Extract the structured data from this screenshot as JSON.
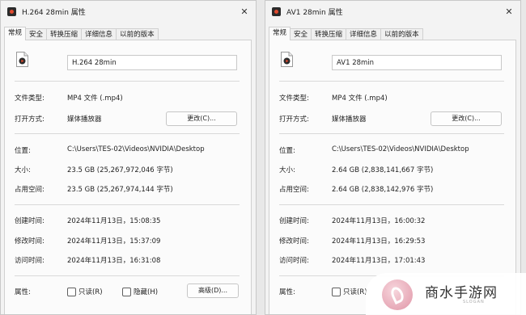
{
  "windows": [
    {
      "title": "H.264 28min 属性",
      "tabs": [
        "常规",
        "安全",
        "转换压缩",
        "详细信息",
        "以前的版本"
      ],
      "file_name": "H.264 28min",
      "file_type_label": "文件类型:",
      "file_type": "MP4 文件 (.mp4)",
      "open_with_label": "打开方式:",
      "open_with": "媒体播放器",
      "change_button": "更改(C)...",
      "location_label": "位置:",
      "location": "C:\\Users\\TES-02\\Videos\\NVIDIA\\Desktop",
      "size_label": "大小:",
      "size": "23.5 GB (25,267,972,046 字节)",
      "size_on_disk_label": "占用空间:",
      "size_on_disk": "23.5 GB (25,267,974,144 字节)",
      "created_label": "创建时间:",
      "created": "2024年11月13日，15:08:35",
      "modified_label": "修改时间:",
      "modified": "2024年11月13日，15:37:09",
      "accessed_label": "访问时间:",
      "accessed": "2024年11月13日，16:31:08",
      "attributes_label": "属性:",
      "readonly_label": "只读(R)",
      "hidden_label": "隐藏(H)",
      "advanced_button": "高级(D)..."
    },
    {
      "title": "AV1 28min 属性",
      "tabs": [
        "常规",
        "安全",
        "转换压缩",
        "详细信息",
        "以前的版本"
      ],
      "file_name": "AV1 28min",
      "file_type_label": "文件类型:",
      "file_type": "MP4 文件 (.mp4)",
      "open_with_label": "打开方式:",
      "open_with": "媒体播放器",
      "change_button": "更改(C)...",
      "location_label": "位置:",
      "location": "C:\\Users\\TES-02\\Videos\\NVIDIA\\Desktop",
      "size_label": "大小:",
      "size": "2.64 GB (2,838,141,667 字节)",
      "size_on_disk_label": "占用空间:",
      "size_on_disk": "2.64 GB (2,838,142,976 字节)",
      "created_label": "创建时间:",
      "created": "2024年11月13日，16:00:32",
      "modified_label": "修改时间:",
      "modified": "2024年11月13日，16:29:53",
      "accessed_label": "访问时间:",
      "accessed": "2024年11月13日，17:01:43",
      "attributes_label": "属性:",
      "readonly_label": "只读(R)"
    }
  ],
  "close_glyph": "✕",
  "watermark": {
    "text": "商水手游网",
    "sub": "SLOGAN"
  },
  "colors": {
    "window_bg": "#f3f3f3",
    "panel_bg": "#fbfbfb",
    "app_icon": "#e04a2f"
  }
}
